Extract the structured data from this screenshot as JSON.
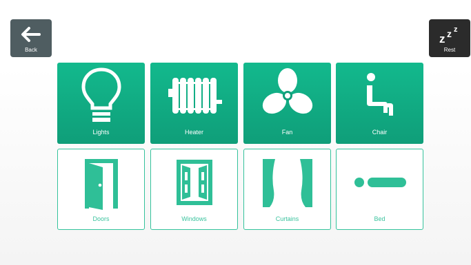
{
  "header": {
    "back_label": "Back",
    "rest_label": "Rest"
  },
  "tiles": [
    {
      "label": "Lights",
      "icon": "lightbulb-icon",
      "state": "active"
    },
    {
      "label": "Heater",
      "icon": "radiator-icon",
      "state": "active"
    },
    {
      "label": "Fan",
      "icon": "fan-icon",
      "state": "active"
    },
    {
      "label": "Chair",
      "icon": "chair-icon",
      "state": "active"
    },
    {
      "label": "Doors",
      "icon": "door-icon",
      "state": "inactive"
    },
    {
      "label": "Windows",
      "icon": "window-icon",
      "state": "inactive"
    },
    {
      "label": "Curtains",
      "icon": "curtains-icon",
      "state": "inactive"
    },
    {
      "label": "Bed",
      "icon": "bed-icon",
      "state": "inactive"
    }
  ],
  "colors": {
    "accent": "#13b98d",
    "accent_dark": "#0f9e79",
    "back_button": "#4f5d61",
    "rest_button": "#2b2b2b"
  }
}
